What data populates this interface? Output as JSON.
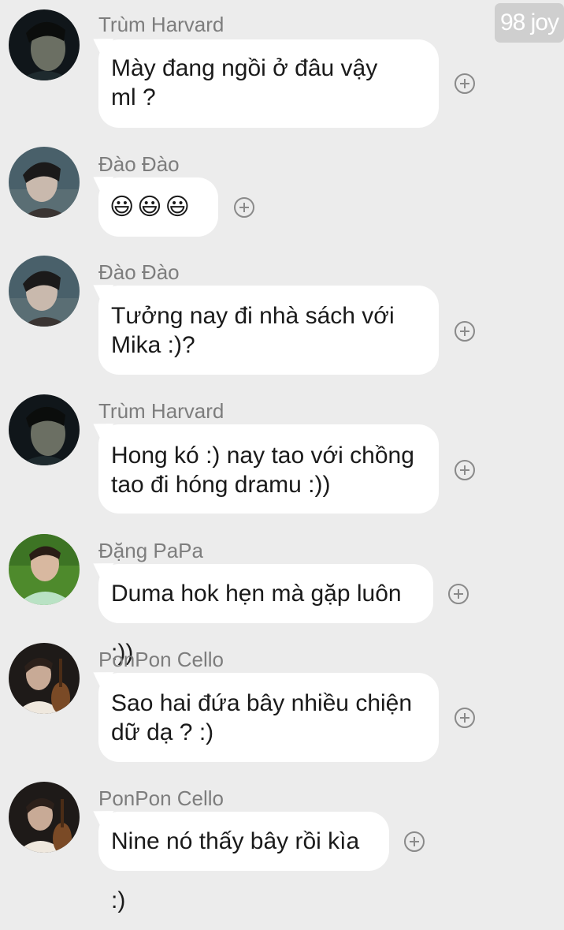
{
  "watermark": "98 joy",
  "messages": [
    {
      "sender": "Trùm Harvard",
      "text_lines": [
        "Mày đang ngồi ở đâu vậy",
        "ml ?"
      ],
      "avatar": "dark-boy-avatar"
    },
    {
      "sender": "Đào Đào",
      "emoji": [
        "😃",
        "😃",
        "😃"
      ],
      "avatar": "sea-boy-avatar"
    },
    {
      "sender": "Đào Đào",
      "text_lines": [
        "Tưởng nay đi nhà sách với",
        "Mika :)?"
      ],
      "avatar": "sea-boy-avatar"
    },
    {
      "sender": "Trùm Harvard",
      "text_lines": [
        "Hong kó :) nay tao với chồng",
        "tao đi hóng dramu :))"
      ],
      "avatar": "dark-boy-avatar"
    },
    {
      "sender": "Đặng PaPa",
      "text_lines": [
        "Duma hok hẹn mà gặp luôn :))"
      ],
      "avatar": "green-boy-avatar"
    },
    {
      "sender": "PonPon Cello",
      "text_lines": [
        "Sao hai đứa bây nhiều chiện",
        "dữ dạ ? :)"
      ],
      "avatar": "cello-boy-avatar"
    },
    {
      "sender": "PonPon Cello",
      "text_lines": [
        "Nine nó thấy bây rồi kìa :)"
      ],
      "avatar": "cello-boy-avatar"
    }
  ],
  "colors": {
    "background": "#ececec",
    "bubble": "#ffffff",
    "sender": "#7d7d7d",
    "text": "#1a1a1a",
    "icon": "#8a8a8a"
  },
  "icons": {
    "react": "plus-circle-icon"
  }
}
